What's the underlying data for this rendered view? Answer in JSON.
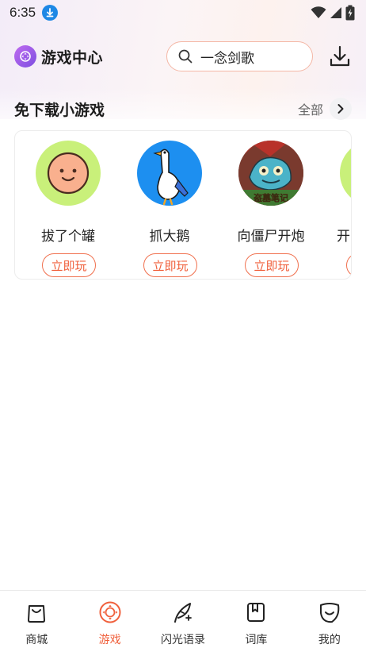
{
  "status_bar": {
    "time": "6:35"
  },
  "header": {
    "app_title": "游戏中心",
    "search": {
      "value": "一念剑歌"
    }
  },
  "section": {
    "title": "免下载小游戏",
    "more_label": "全部"
  },
  "games": [
    {
      "name": "拔了个罐",
      "play_label": "立即玩"
    },
    {
      "name": "抓大鹅",
      "play_label": "立即玩"
    },
    {
      "name": "向僵尸开炮",
      "play_label": "立即玩",
      "icon_text": "盗墓笔记"
    },
    {
      "name": "开"
    }
  ],
  "bottom_nav": [
    {
      "label": "商城",
      "icon": "shop-bag-icon"
    },
    {
      "label": "游戏",
      "icon": "game-controller-icon",
      "active": true
    },
    {
      "label": "闪光语录",
      "icon": "feather-pen-icon"
    },
    {
      "label": "词库",
      "icon": "bookmark-book-icon"
    },
    {
      "label": "我的",
      "icon": "smile-face-icon"
    }
  ],
  "colors": {
    "accent": "#f0603c",
    "logo": "#9a5ce8",
    "status_download_badge": "#1e88e5"
  }
}
